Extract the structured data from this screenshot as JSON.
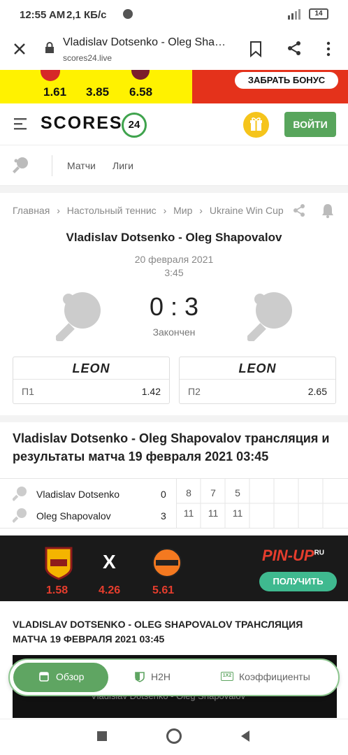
{
  "status_bar": {
    "time": "12:55 AM",
    "network": "2,1 КБ/с",
    "battery": "14"
  },
  "browser": {
    "title": "Vladislav Dotsenko - Oleg Shapoval...",
    "url": "scores24.live"
  },
  "top_ad": {
    "odds": [
      "1.61",
      "3.85",
      "6.58"
    ],
    "bonus_label": "ЗАБРАТЬ БОНУС",
    "colors": {
      "left": "#fff200",
      "right": "#e4321b"
    }
  },
  "header": {
    "logo_text": "SCORES",
    "logo_number": "24",
    "login_label": "ВОЙТИ",
    "accent": "#58a55c"
  },
  "subnav": {
    "items": [
      "Матчи",
      "Лиги"
    ]
  },
  "breadcrumb": [
    "Главная",
    "Настольный теннис",
    "Мир",
    "Ukraine Win Cup"
  ],
  "match": {
    "title": "Vladislav Dotsenko - Oleg Shapovalov",
    "date": "20 февраля 2021",
    "time": "3:45",
    "score": "0 : 3",
    "status": "Закончен"
  },
  "odds": [
    {
      "bookmaker": "LEON",
      "label": "П1",
      "value": "1.42"
    },
    {
      "bookmaker": "LEON",
      "label": "П2",
      "value": "2.65"
    }
  ],
  "section_title": "Vladislav Dotsenko - Oleg Shapovalov трансляция и результаты матча 19 февраля 2021 03:45",
  "sets_table": {
    "rows": [
      {
        "player": "Vladislav Dotsenko",
        "total": "0",
        "sets": [
          "8",
          "7",
          "5"
        ]
      },
      {
        "player": "Oleg Shapovalov",
        "total": "3",
        "sets": [
          "11",
          "11",
          "11"
        ]
      }
    ]
  },
  "mid_ad": {
    "odds": [
      "1.58",
      "4.26",
      "5.61"
    ],
    "x": "X",
    "brand": "PIN-UP",
    "brand_suffix": "RU",
    "cta": "ПОЛУЧИТЬ",
    "left_team": "ROMA",
    "right_team": "SHAKHTAR"
  },
  "stream_title": "VLADISLAV DOTSENKO - OLEG SHAPOVALOV ТРАНСЛЯЦИЯ МАТЧА 19 ФЕВРАЛЯ 2021 03:45",
  "video_caption": "Vladislav Dotsenko - Oleg Shapovalov",
  "tabs": [
    {
      "label": "Обзор",
      "icon": "overview-icon"
    },
    {
      "label": "H2H",
      "icon": "h2h-icon"
    },
    {
      "label": "Коэффициенты",
      "icon": "odds-icon"
    }
  ]
}
